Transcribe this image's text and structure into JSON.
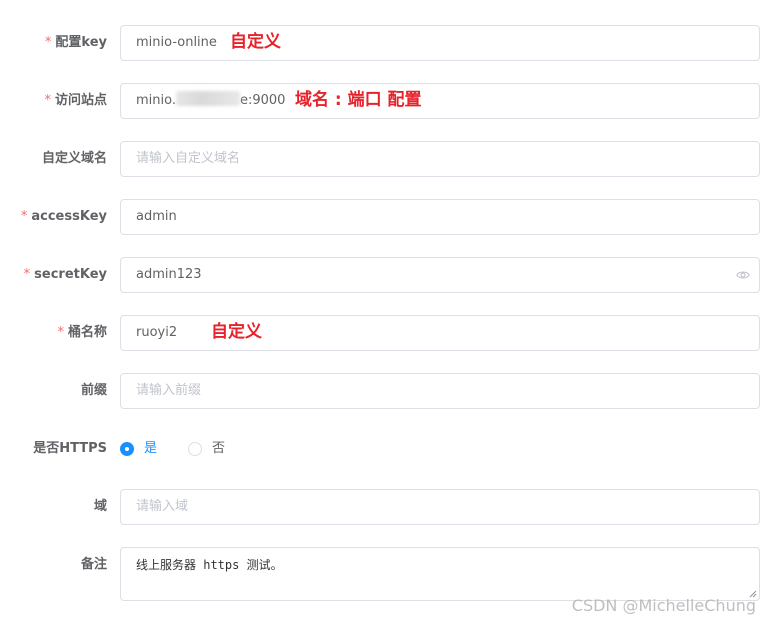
{
  "form": {
    "config_key": {
      "label": "配置key",
      "required": "*",
      "value": "minio-online",
      "note": "自定义"
    },
    "endpoint": {
      "label": "访问站点",
      "required": "*",
      "value_prefix": "minio.",
      "value_suffix": "e:9000",
      "note": "域名 : 端口 配置"
    },
    "custom_domain": {
      "label": "自定义域名",
      "placeholder": "请输入自定义域名"
    },
    "access_key": {
      "label": "accessKey",
      "required": "*",
      "value": "admin"
    },
    "secret_key": {
      "label": "secretKey",
      "required": "*",
      "value": "admin123",
      "icon": "eye-icon"
    },
    "bucket_name": {
      "label": "桶名称",
      "required": "*",
      "value": "ruoyi2",
      "note": "自定义"
    },
    "prefix": {
      "label": "前缀",
      "placeholder": "请输入前缀"
    },
    "https": {
      "label": "是否HTTPS",
      "options": [
        "是",
        "否"
      ],
      "selected": "是"
    },
    "region": {
      "label": "域",
      "placeholder": "请输入域"
    },
    "remark": {
      "label": "备注",
      "value": "线上服务器 https 测试。"
    }
  },
  "watermark": "CSDN @MichelleChung",
  "colors": {
    "accent": "#1890ff",
    "required": "#f56c6c",
    "annotation": "#e8222a",
    "border": "#dcdfe6"
  }
}
